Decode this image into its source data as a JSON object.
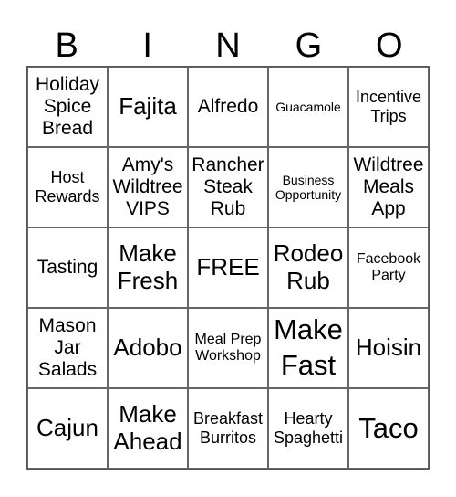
{
  "header": [
    "B",
    "I",
    "N",
    "G",
    "O"
  ],
  "cells": [
    "Holiday Spice Bread",
    "Fajita",
    "Alfredo",
    "Guacamole",
    "Incentive Trips",
    "Host Rewards",
    "Amy's Wildtree VIPS",
    "Rancher Steak Rub",
    "Business Opportunity",
    "Wildtree Meals App",
    "Tasting",
    "Make Fresh",
    "FREE",
    "Rodeo Rub",
    "Facebook Party",
    "Mason Jar Salads",
    "Adobo",
    "Meal Prep Workshop",
    "Make Fast",
    "Hoisin",
    "Cajun",
    "Make Ahead",
    "Breakfast Burritos",
    "Hearty Spaghetti",
    "Taco"
  ]
}
